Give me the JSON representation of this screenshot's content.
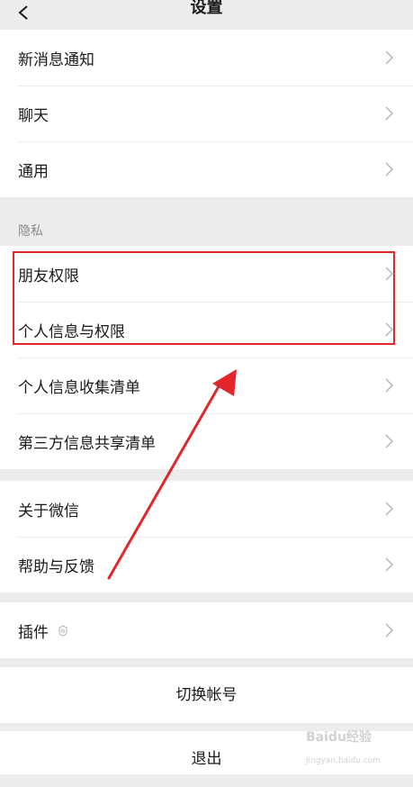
{
  "header": {
    "title": "设置",
    "back_icon": "chevron-left-icon"
  },
  "groups": [
    {
      "items": [
        {
          "label": "新消息通知"
        },
        {
          "label": "聊天"
        },
        {
          "label": "通用"
        }
      ]
    },
    {
      "section_label": "隐私",
      "items": [
        {
          "label": "朋友权限"
        },
        {
          "label": "个人信息与权限"
        },
        {
          "label": "个人信息收集清单"
        },
        {
          "label": "第三方信息共享清单"
        }
      ]
    },
    {
      "items": [
        {
          "label": "关于微信"
        },
        {
          "label": "帮助与反馈"
        }
      ]
    },
    {
      "items": [
        {
          "label": "插件",
          "icon": "plugin-icon"
        }
      ]
    }
  ],
  "actions": {
    "switch_account": "切换帐号",
    "logout": "退出"
  },
  "annotation": {
    "highlight_color": "#e3262b",
    "arrow_color": "#e3262b"
  },
  "watermark": {
    "text": "Baidu经验",
    "sub": "jingyan.baidu.com"
  }
}
